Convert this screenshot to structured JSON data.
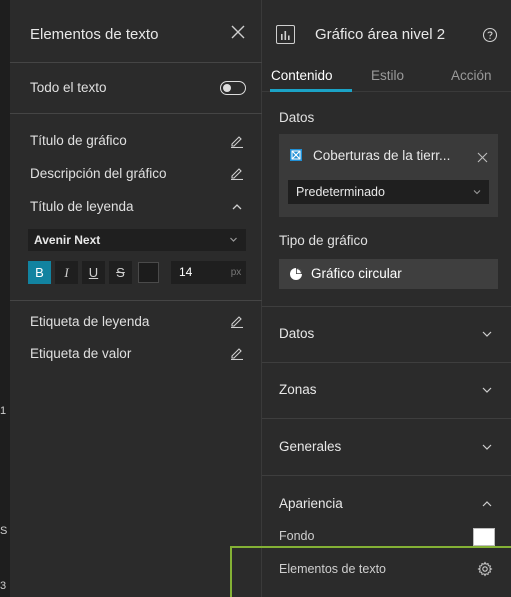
{
  "left_panel": {
    "title": "Elementos de texto",
    "all_text_label": "Todo el texto",
    "items": [
      {
        "label": "Título de gráfico"
      },
      {
        "label": "Descripción del gráfico"
      },
      {
        "label": "Título de leyenda"
      },
      {
        "label": "Etiqueta de leyenda"
      },
      {
        "label": "Etiqueta de valor"
      }
    ],
    "font": {
      "family_value": "Avenir Next",
      "bold": "B",
      "italic": "I",
      "underline": "U",
      "strike": "S",
      "size_value": "14",
      "size_unit": "px"
    },
    "edge_letters": [
      "1",
      "S",
      "3"
    ]
  },
  "right_panel": {
    "title": "Gráfico área nivel 2",
    "tabs": [
      {
        "label": "Contenido",
        "active": true
      },
      {
        "label": "Estilo",
        "active": false
      },
      {
        "label": "Acción",
        "active": false
      }
    ],
    "data_section_label": "Datos",
    "source_name": "Coberturas de la tierr...",
    "preset_value": "Predeterminado",
    "chart_type_label": "Tipo de gráfico",
    "chart_type_value": "Gráfico circular",
    "accordions": [
      {
        "label": "Datos",
        "expanded": false
      },
      {
        "label": "Zonas",
        "expanded": false
      },
      {
        "label": "Generales",
        "expanded": false
      },
      {
        "label": "Apariencia",
        "expanded": true
      }
    ],
    "fondo_label": "Fondo",
    "text_elements_label": "Elementos de texto"
  },
  "colors": {
    "accent": "#1ba3c6",
    "active_button": "#1283a0",
    "highlight_box": "#84b135",
    "background": "#2b2b2b"
  },
  "icons": {
    "close": "close-icon",
    "edit": "pencil-icon",
    "help": "help-icon",
    "settings": "gear-icon",
    "chart": "bar-chart-icon",
    "pie": "pie-chart-icon",
    "layer": "layer-icon"
  }
}
